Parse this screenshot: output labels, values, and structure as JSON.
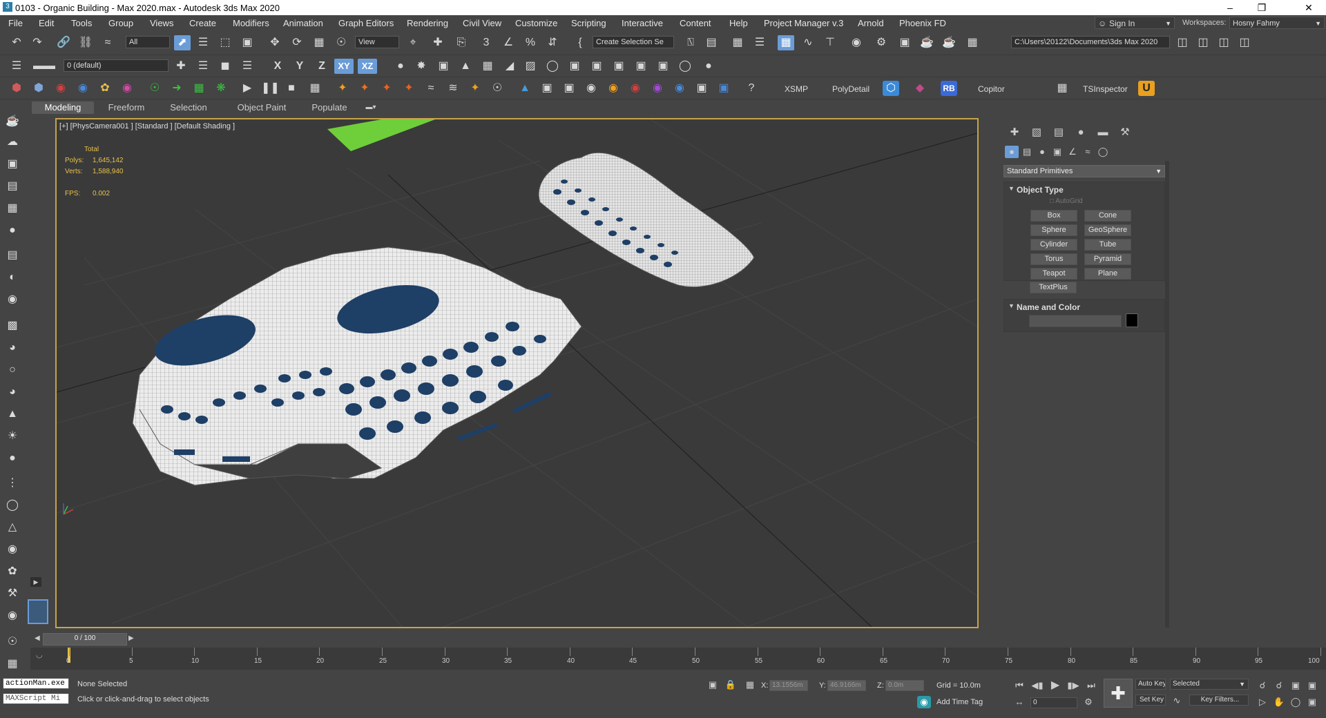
{
  "window": {
    "title": "0103 - Organic Building - Max 2020.max - Autodesk 3ds Max 2020",
    "minimize_icon": "minimize-icon",
    "maximize_icon": "restore-icon",
    "close_icon": "close-icon"
  },
  "menu": {
    "items": [
      "File",
      "Edit",
      "Tools",
      "Group",
      "Views",
      "Create",
      "Modifiers",
      "Animation",
      "Graph Editors",
      "Rendering",
      "Civil View",
      "Customize",
      "Scripting",
      "Interactive",
      "Content",
      "Help",
      "Project Manager v.3",
      "Arnold",
      "Phoenix FD"
    ],
    "sign_in": "Sign In",
    "workspaces_label": "Workspaces:",
    "workspace": "Hosny Fahmy"
  },
  "toolbar1": {
    "filter": "All",
    "view": "View",
    "selection_set": "Create Selection Se",
    "path": "C:\\Users\\20122\\Documents\\3ds Max 2020"
  },
  "toolbar2": {
    "layer": "0 (default)",
    "axes": [
      "X",
      "Y",
      "Z",
      "XY",
      "XZ"
    ]
  },
  "toolbar3": {
    "labels": [
      "XSMP",
      "PolyDetail",
      "RB",
      "Copitor",
      "TSInspector"
    ]
  },
  "ribbon": {
    "tabs": [
      "Modeling",
      "Freeform",
      "Selection",
      "Object Paint",
      "Populate"
    ]
  },
  "viewport": {
    "label": "[+] [PhysCamera001 ] [Standard ] [Default Shading ]",
    "stats_total": "Total",
    "polys_label": "Polys:",
    "polys_value": "1,645,142",
    "verts_label": "Verts:",
    "verts_value": "1,588,940",
    "fps_label": "FPS:",
    "fps_value": "0.002"
  },
  "command_panel": {
    "dropdown": "Standard Primitives",
    "object_type_title": "Object Type",
    "autogrid": "AutoGrid",
    "primitives": [
      "Box",
      "Cone",
      "Sphere",
      "GeoSphere",
      "Cylinder",
      "Tube",
      "Torus",
      "Pyramid",
      "Teapot",
      "Plane",
      "TextPlus"
    ],
    "name_color_title": "Name and Color"
  },
  "timeline": {
    "frame_counter": "0 / 100",
    "ticks": [
      "0",
      "5",
      "10",
      "15",
      "20",
      "25",
      "30",
      "35",
      "40",
      "45",
      "50",
      "55",
      "60",
      "65",
      "70",
      "75",
      "80",
      "85",
      "90",
      "95",
      "100"
    ]
  },
  "status": {
    "maxscript1": "actionMan.exe",
    "maxscript2": "MAXScript Mi",
    "selection": "None Selected",
    "prompt": "Click or click-and-drag to select objects",
    "x_label": "X:",
    "x_value": "13.1556m",
    "y_label": "Y:",
    "y_value": "46.9166m",
    "z_label": "Z:",
    "z_value": "0.0m",
    "grid": "Grid = 10.0m",
    "add_time_tag": "Add Time Tag",
    "auto_key": "Auto Key",
    "set_key": "Set Key",
    "selected": "Selected",
    "key_filters": "Key Filters...",
    "frame": "0"
  },
  "colors": {
    "accent": "#6a9cd8",
    "viewport_border": "#c8a44a",
    "stats": "#e8c24a",
    "ground_plane": "#6fcf3a"
  }
}
